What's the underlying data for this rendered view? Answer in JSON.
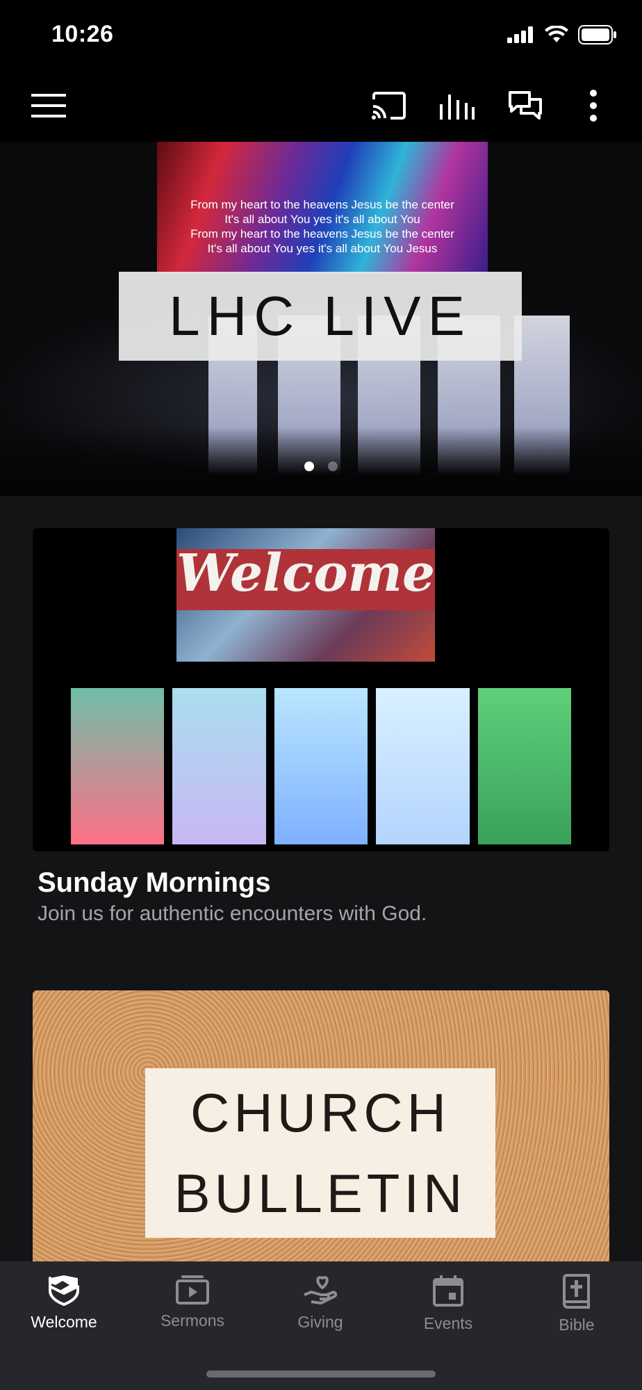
{
  "status_bar": {
    "time": "10:26",
    "icons": [
      "cellular-signal-icon",
      "wifi-icon",
      "battery-icon"
    ]
  },
  "app_bar": {
    "icons": [
      "menu-icon",
      "cast-icon",
      "audio-bars-icon",
      "chat-icon",
      "more-vert-icon"
    ]
  },
  "hero": {
    "lyrics": [
      "From my heart to the heavens Jesus be the center",
      "It's all about You yes it's all about You",
      "From my heart to the heavens Jesus be the center",
      "It's all about You yes it's all about You Jesus"
    ],
    "title": "LHC LIVE",
    "carousel_pages": 2,
    "carousel_active": 1
  },
  "cards": [
    {
      "image_text": "Welcome",
      "title": "Sunday Mornings",
      "subtitle": "Join us for authentic encounters with God."
    },
    {
      "image_lines": [
        "CHURCH",
        "BULLETIN"
      ]
    }
  ],
  "tabs": [
    {
      "label": "Welcome",
      "icon": "handshake-shield-icon",
      "active": true
    },
    {
      "label": "Sermons",
      "icon": "video-library-icon",
      "active": false
    },
    {
      "label": "Giving",
      "icon": "heart-hand-icon",
      "active": false
    },
    {
      "label": "Events",
      "icon": "calendar-icon",
      "active": false
    },
    {
      "label": "Bible",
      "icon": "bible-book-icon",
      "active": false
    }
  ],
  "colors": {
    "background": "#131415",
    "tab_bar": "#26272a",
    "active_tab": "#ffffff",
    "inactive_tab": "#8c8e92"
  }
}
